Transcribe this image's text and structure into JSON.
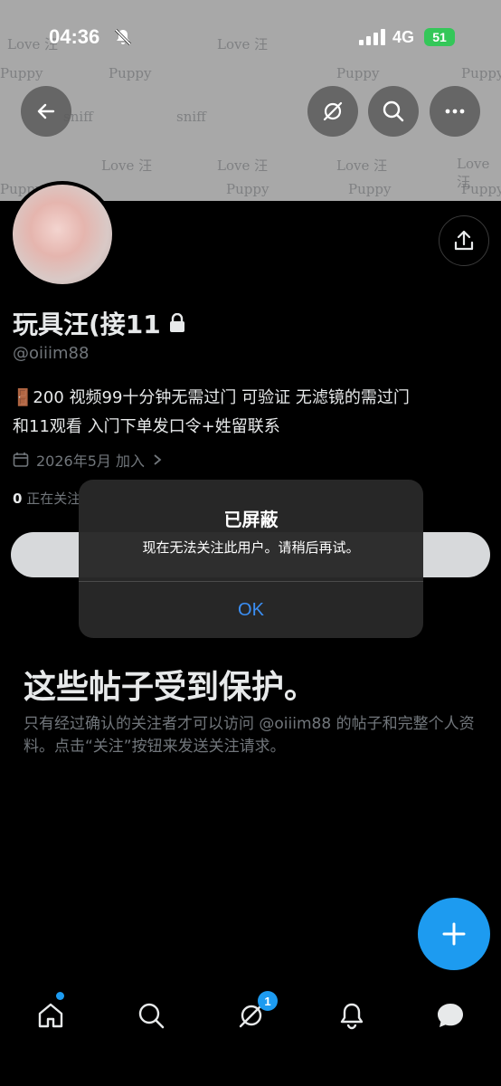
{
  "status_bar": {
    "time": "04:36",
    "network": "4G",
    "battery": "51"
  },
  "profile": {
    "name": "玩具汪(接11",
    "handle": "@oiiim88",
    "bio_line1": "🚪200 视频99十分钟无需过门 可验证 无滤镜的需过门",
    "bio_line2": "和11观看 入门下单发口令+姓留联系",
    "joined": "2026年5月 加入",
    "following_count": "0",
    "following_label": "正在关注"
  },
  "protected": {
    "title": "这些帖子受到保护。",
    "description": "只有经过确认的关注者才可以访问 @oiiim88 的帖子和完整个人资料。点击“关注”按钮来发送关注请求。"
  },
  "alert": {
    "title": "已屏蔽",
    "message": "现在无法关注此用户。请稍后再试。",
    "ok_label": "OK"
  },
  "tabbar": {
    "messages_badge": "1"
  },
  "colors": {
    "accent": "#1d9bf0",
    "alert_button": "#3b8ff5"
  },
  "icons": [
    "back-icon",
    "grok-icon",
    "search-icon",
    "more-icon",
    "share-icon",
    "lock-icon",
    "calendar-icon",
    "chevron-right-icon",
    "plus-icon",
    "home-icon",
    "explore-icon",
    "grok-tab-icon",
    "bell-icon",
    "messages-icon"
  ]
}
